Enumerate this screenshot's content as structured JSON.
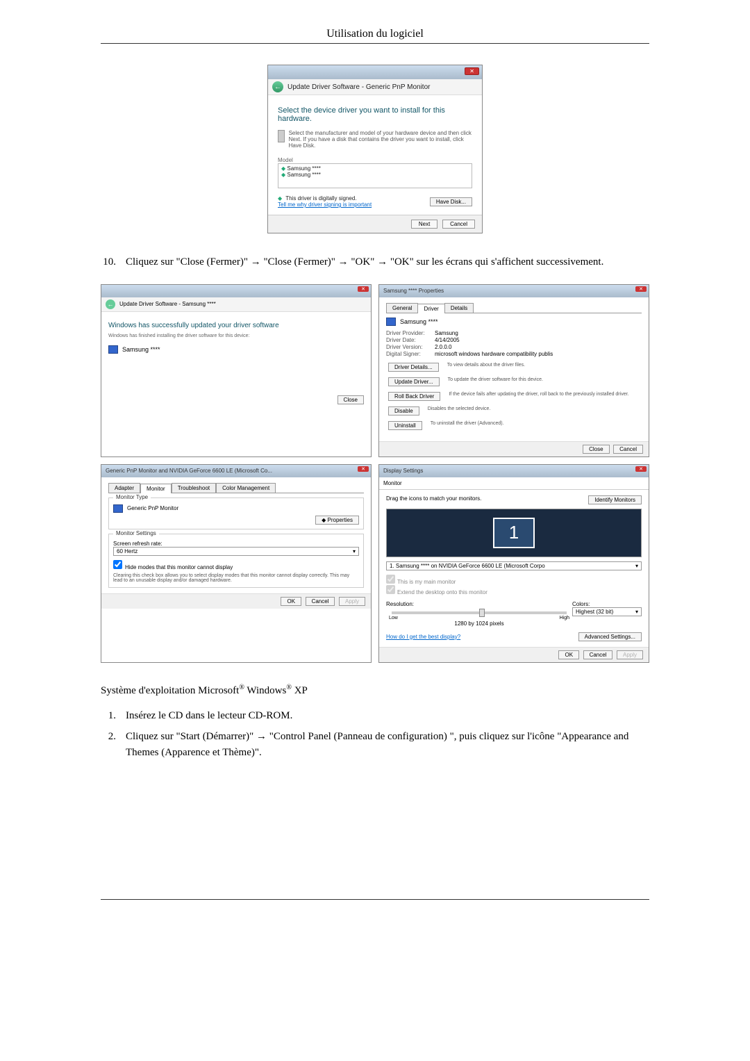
{
  "header": {
    "title": "Utilisation du logiciel"
  },
  "dlg1": {
    "breadcrumb": "Update Driver Software - Generic PnP Monitor",
    "headline": "Select the device driver you want to install for this hardware.",
    "info": "Select the manufacturer and model of your hardware device and then click Next. If you have a disk that contains the driver you want to install, click Have Disk.",
    "model_label": "Model",
    "models": [
      "Samsung ****",
      "Samsung ****"
    ],
    "signed_text": "This driver is digitally signed.",
    "signed_link": "Tell me why driver signing is important",
    "have_disk": "Have Disk...",
    "next": "Next",
    "cancel": "Cancel"
  },
  "step10": {
    "num": "10.",
    "text": "Cliquez sur \"Close (Fermer)\" → \"Close (Fermer)\" → \"OK\" → \"OK\" sur les écrans qui s'affichent successivement."
  },
  "panelA": {
    "breadcrumb": "Update Driver Software - Samsung ****",
    "headline": "Windows has successfully updated your driver software",
    "sub": "Windows has finished installing the driver software for this device:",
    "device": "Samsung ****",
    "close": "Close"
  },
  "panelB": {
    "title": "Samsung **** Properties",
    "tabs": {
      "general": "General",
      "driver": "Driver",
      "details": "Details"
    },
    "device": "Samsung ****",
    "pairs": {
      "provider_k": "Driver Provider:",
      "provider_v": "Samsung",
      "date_k": "Driver Date:",
      "date_v": "4/14/2005",
      "version_k": "Driver Version:",
      "version_v": "2.0.0.0",
      "signer_k": "Digital Signer:",
      "signer_v": "microsoft windows hardware compatibility publis"
    },
    "btn_details": "Driver Details...",
    "desc_details": "To view details about the driver files.",
    "btn_update": "Update Driver...",
    "desc_update": "To update the driver software for this device.",
    "btn_rollback": "Roll Back Driver",
    "desc_rollback": "If the device fails after updating the driver, roll back to the previously installed driver.",
    "btn_disable": "Disable",
    "desc_disable": "Disables the selected device.",
    "btn_uninstall": "Uninstall",
    "desc_uninstall": "To uninstall the driver (Advanced).",
    "close": "Close",
    "cancel": "Cancel"
  },
  "panelC": {
    "title": "Generic PnP Monitor and NVIDIA GeForce 6600 LE (Microsoft Co...",
    "tabs": {
      "adapter": "Adapter",
      "monitor": "Monitor",
      "troubleshoot": "Troubleshoot",
      "color": "Color Management"
    },
    "group_type": "Monitor Type",
    "monitor_name": "Generic PnP Monitor",
    "properties": "Properties",
    "group_settings": "Monitor Settings",
    "refresh_label": "Screen refresh rate:",
    "refresh_value": "60 Hertz",
    "hide_cb": "Hide modes that this monitor cannot display",
    "hide_note": "Clearing this check box allows you to select display modes that this monitor cannot display correctly. This may lead to an unusable display and/or damaged hardware.",
    "ok": "OK",
    "cancel": "Cancel",
    "apply": "Apply"
  },
  "panelD": {
    "title": "Display Settings",
    "tab": "Monitor",
    "drag_text": "Drag the icons to match your monitors.",
    "identify": "Identify Monitors",
    "monitor_number": "1",
    "dropdown": "1. Samsung **** on NVIDIA GeForce 6600 LE (Microsoft Corpo",
    "cb_main": "This is my main monitor",
    "cb_extend": "Extend the desktop onto this monitor",
    "res_label": "Resolution:",
    "low": "Low",
    "high": "High",
    "res_value": "1280 by 1024 pixels",
    "colors_label": "Colors:",
    "colors_value": "Highest (32 bit)",
    "help_link": "How do I get the best display?",
    "advanced": "Advanced Settings...",
    "ok": "OK",
    "cancel": "Cancel",
    "apply": "Apply"
  },
  "xp_section": {
    "os_prefix": "Système d'exploitation Microsoft",
    "os_middle": " Windows",
    "os_suffix": " XP",
    "reg": "®",
    "step1_num": "1.",
    "step1_text": "Insérez le CD dans le lecteur CD-ROM.",
    "step2_num": "2.",
    "step2_text": "Cliquez sur \"Start (Démarrer)\" → \"Control Panel (Panneau de configuration) \", puis cliquez sur l'icône \"Appearance and Themes (Apparence et Thème)\"."
  }
}
